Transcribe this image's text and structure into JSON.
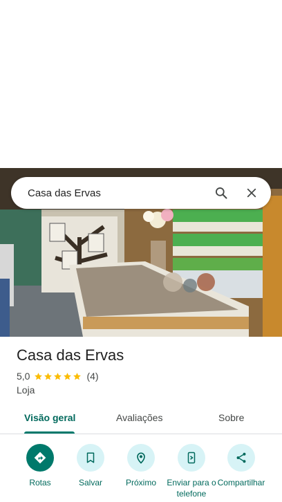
{
  "search": {
    "query": "Casa das Ervas"
  },
  "place": {
    "name": "Casa das Ervas",
    "rating": "5,0",
    "stars": 5,
    "review_count": "(4)",
    "category": "Loja"
  },
  "tabs": [
    {
      "label": "Visão geral",
      "active": true
    },
    {
      "label": "Avaliações",
      "active": false
    },
    {
      "label": "Sobre",
      "active": false
    }
  ],
  "actions": [
    {
      "label": "Rotas",
      "icon": "directions-icon"
    },
    {
      "label": "Salvar",
      "icon": "bookmark-icon"
    },
    {
      "label": "Próximo",
      "icon": "nearby-icon"
    },
    {
      "label": "Enviar para o telefone",
      "icon": "send-to-phone-icon"
    },
    {
      "label": "Compartilhar",
      "icon": "share-icon"
    }
  ],
  "colors": {
    "accent": "#00796b",
    "star": "#fbbc04",
    "chip": "#d7f3f6"
  }
}
